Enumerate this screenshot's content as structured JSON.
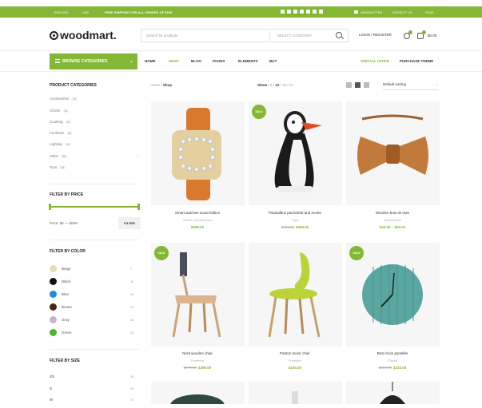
{
  "topbar": {
    "language": "ENGLISH",
    "currency": "USD",
    "shipping": "FREE SHIPPING FOR ALL ORDERS OF $150",
    "social_icons": [
      "facebook-icon",
      "twitter-icon",
      "google-icon",
      "email-icon",
      "instagram-icon",
      "pinterest-icon",
      "linkedin-icon"
    ],
    "newsletter": "NEWSLETTER",
    "contact": "CONTACT US",
    "faqs": "FAQS"
  },
  "header": {
    "logo": "woodmart.",
    "search_placeholder": "Search for products",
    "select_category": "SELECT CATEGORY",
    "login": "LOGIN / REGISTER",
    "wishlist_count": "0",
    "cart_count": "0",
    "cart_total": "$0.00"
  },
  "nav": {
    "browse": "BROWSE CATEGORIES",
    "items": [
      "HOME",
      "SHOP",
      "BLOG",
      "PAGES",
      "ELEMENTS",
      "BUY"
    ],
    "special": "SPECIAL OFFER",
    "purchase": "PURCHASE THEME"
  },
  "sidebar": {
    "categories_title": "PRODUCT CATEGORIES",
    "categories": [
      {
        "label": "Accessories",
        "count": "12"
      },
      {
        "label": "Clocks",
        "count": "14"
      },
      {
        "label": "Cooking",
        "count": "12"
      },
      {
        "label": "Furniture",
        "count": "19"
      },
      {
        "label": "Lighting",
        "count": "16"
      },
      {
        "label": "Other",
        "count": "26"
      },
      {
        "label": "Toys",
        "count": "13"
      }
    ],
    "price_title": "FILTER BY PRICE",
    "price_range": "Price: $5 — $699",
    "filter_button": "FILTER",
    "color_title": "FILTER BY COLOR",
    "colors": [
      {
        "label": "Beige",
        "count": "7",
        "color": "#e9dcb3"
      },
      {
        "label": "Black",
        "count": "11",
        "color": "#111111"
      },
      {
        "label": "Blue",
        "count": "10",
        "color": "#1e8ed8"
      },
      {
        "label": "Brown",
        "count": "12",
        "color": "#4a2616"
      },
      {
        "label": "Gray",
        "count": "15",
        "color": "#c4b5c9"
      },
      {
        "label": "Green",
        "count": "13",
        "color": "#58b12d"
      }
    ],
    "size_title": "FILTER BY SIZE",
    "sizes": [
      {
        "label": "XS",
        "count": "16"
      },
      {
        "label": "S",
        "count": "16"
      },
      {
        "label": "M",
        "count": "17"
      }
    ]
  },
  "toolbar": {
    "breadcrumb_home": "Home",
    "breadcrumb_current": "Shop",
    "show_label": "Show :",
    "show_options": [
      "9",
      "12",
      "18",
      "24"
    ],
    "sorting": "Default sorting"
  },
  "products": [
    {
      "name": "Smart watches wood edition",
      "category": "Clocks, Accessories",
      "price": "$599.00",
      "old_price": "",
      "sale": false
    },
    {
      "name": "Panasilbus pachuleist and monte",
      "category": "Toys",
      "price": "$459.00",
      "old_price": "$499.00",
      "sale": true,
      "sale_label": "SALE"
    },
    {
      "name": "Wooden bow tie man",
      "category": "Accessories",
      "price": "$45.00 – $59.00",
      "old_price": "",
      "sale": false
    },
    {
      "name": "Nerd wooden chair",
      "category": "Furniture",
      "price": "$399.00",
      "old_price": "$470.00",
      "sale": true,
      "sale_label": "SALE"
    },
    {
      "name": "Panton tunior chair",
      "category": "Furniture",
      "price": "$194.00",
      "old_price": "",
      "sale": false
    },
    {
      "name": "Best clock parallels",
      "category": "Clocks",
      "price": "$333.00",
      "old_price": "$399.00",
      "sale": true,
      "sale_label": "SALE"
    }
  ]
}
